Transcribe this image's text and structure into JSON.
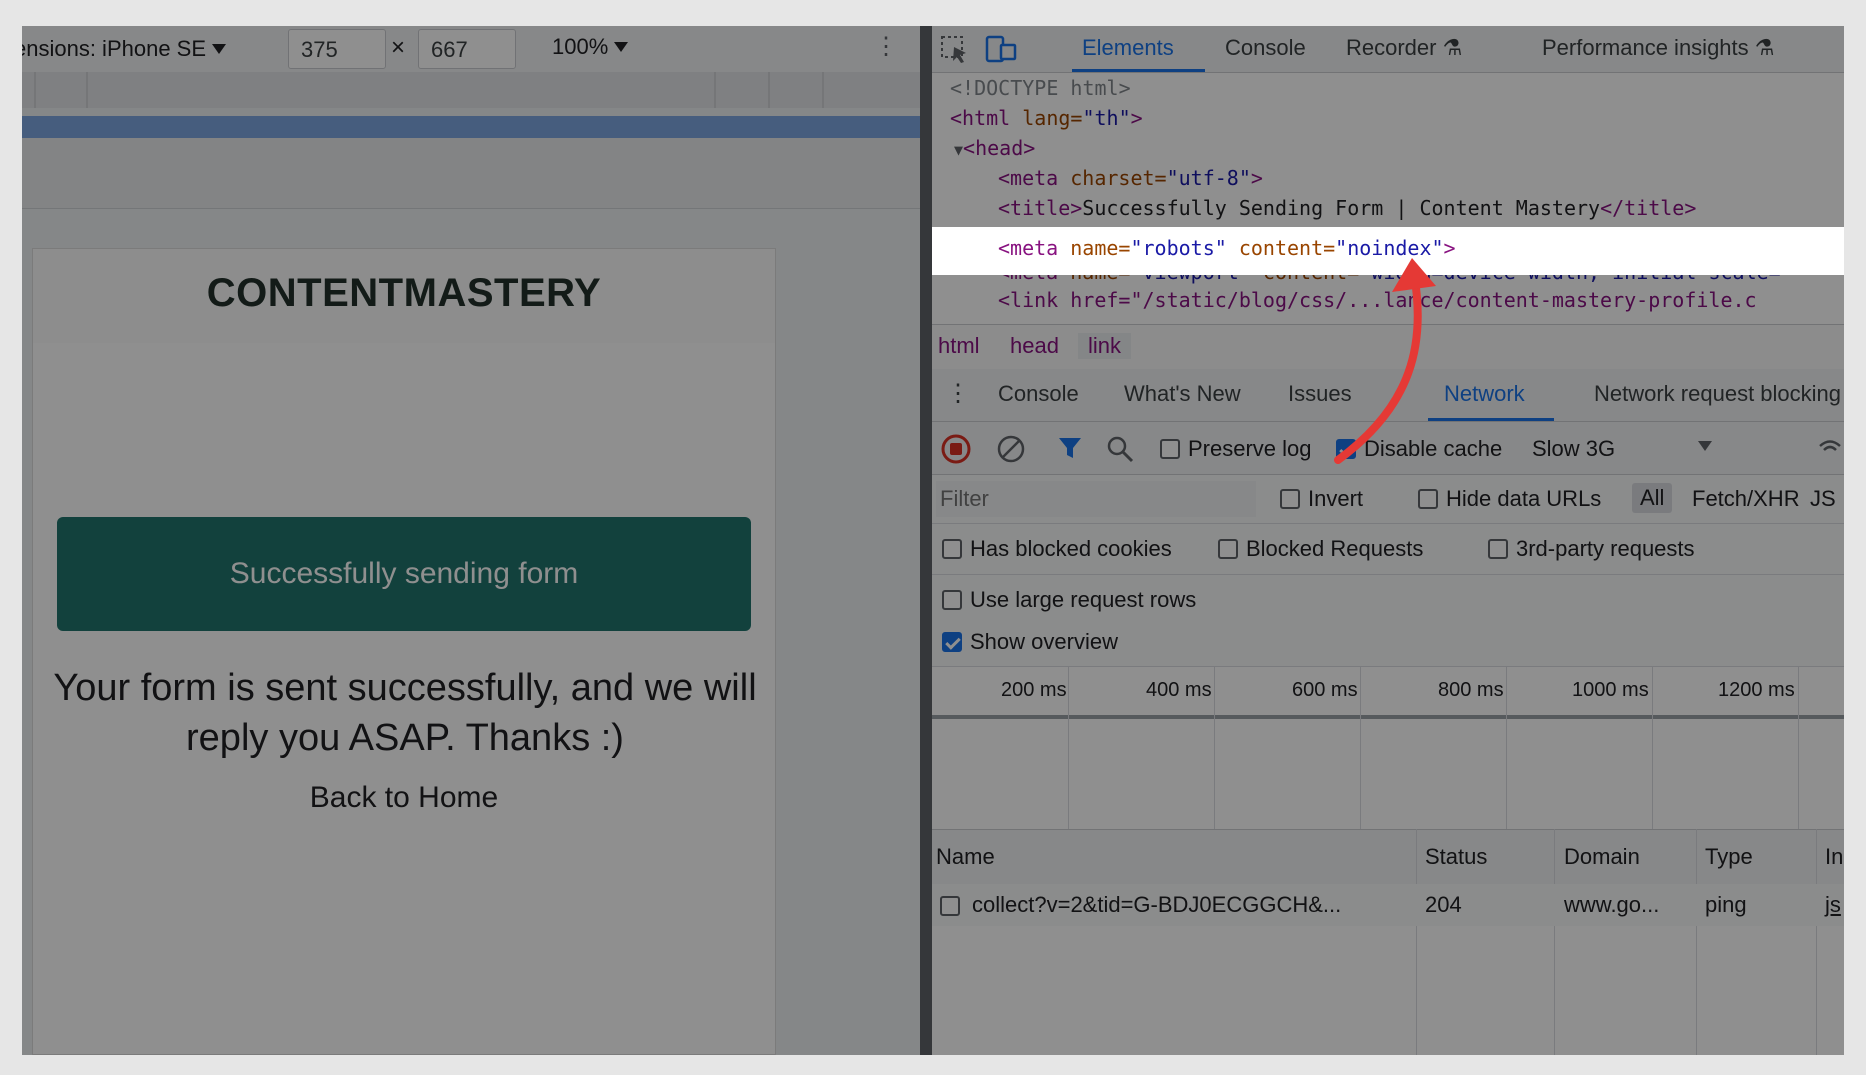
{
  "device_toolbar": {
    "dimensions_label": "ensions: iPhone SE",
    "width": "375",
    "times": "×",
    "height": "667",
    "zoom": "100%"
  },
  "site": {
    "logo": "CONTENTMASTERY",
    "banner": "Successfully sending form",
    "message": "Your form is sent successfully, and we will reply you ASAP. Thanks :)",
    "back_link": "Back to Home"
  },
  "devtools": {
    "tabs": [
      "Elements",
      "Console",
      "Recorder",
      "Performance insights"
    ],
    "active_tab": "Elements",
    "source": {
      "doctype": "<!DOCTYPE html>",
      "html_open": "<html",
      "lang_attr": " lang=",
      "lang_val": "\"th\"",
      "close": ">",
      "head": "<head>",
      "meta_charset_tag": "<meta",
      "meta_charset_attr": " charset=",
      "meta_charset_val": "\"utf-8\"",
      "title_open": "<title>",
      "title_text": "Successfully Sending Form | Content Mastery",
      "title_close": "</title>",
      "meta_tag": "<meta",
      "name_attr": " name=",
      "robots_val": "\"robots\"",
      "content_attr": " content=",
      "noindex_val": "\"noindex\"",
      "viewport_val": "\"viewport\"",
      "viewport_content": "\"width=device-width, initial-scale=",
      "link_line": "<link href=\"/static/blog/css/...lance/content-mastery-profile.c"
    },
    "breadcrumbs": [
      "html",
      "head",
      "link"
    ],
    "drawer_tabs": [
      "Console",
      "What's New",
      "Issues",
      "Network",
      "Network request blocking"
    ],
    "active_drawer_tab": "Network",
    "network": {
      "preserve_log": "Preserve log",
      "disable_cache": "Disable cache",
      "throttle": "Slow 3G",
      "filter_placeholder": "Filter",
      "invert": "Invert",
      "hide_data_urls": "Hide data URLs",
      "type_all": "All",
      "type_fetch": "Fetch/XHR",
      "type_js": "JS",
      "has_blocked_cookies": "Has blocked cookies",
      "blocked_requests": "Blocked Requests",
      "third_party": "3rd-party requests",
      "large_rows": "Use large request rows",
      "show_overview": "Show overview",
      "ticks": [
        "200 ms",
        "400 ms",
        "600 ms",
        "800 ms",
        "1000 ms",
        "1200 ms"
      ],
      "columns": [
        "Name",
        "Status",
        "Domain",
        "Type",
        "In"
      ],
      "rows": [
        {
          "name": "collect?v=2&tid=G-BDJ0ECGGCH&...",
          "status": "204",
          "domain": "www.go...",
          "type": "ping",
          "initiator": "js"
        }
      ]
    }
  },
  "colors": {
    "banner": "#21756d",
    "accent": "#1a73e8",
    "arrow": "#e53935",
    "tag": "#881280",
    "attr": "#994500",
    "val": "#1a1aa6"
  }
}
